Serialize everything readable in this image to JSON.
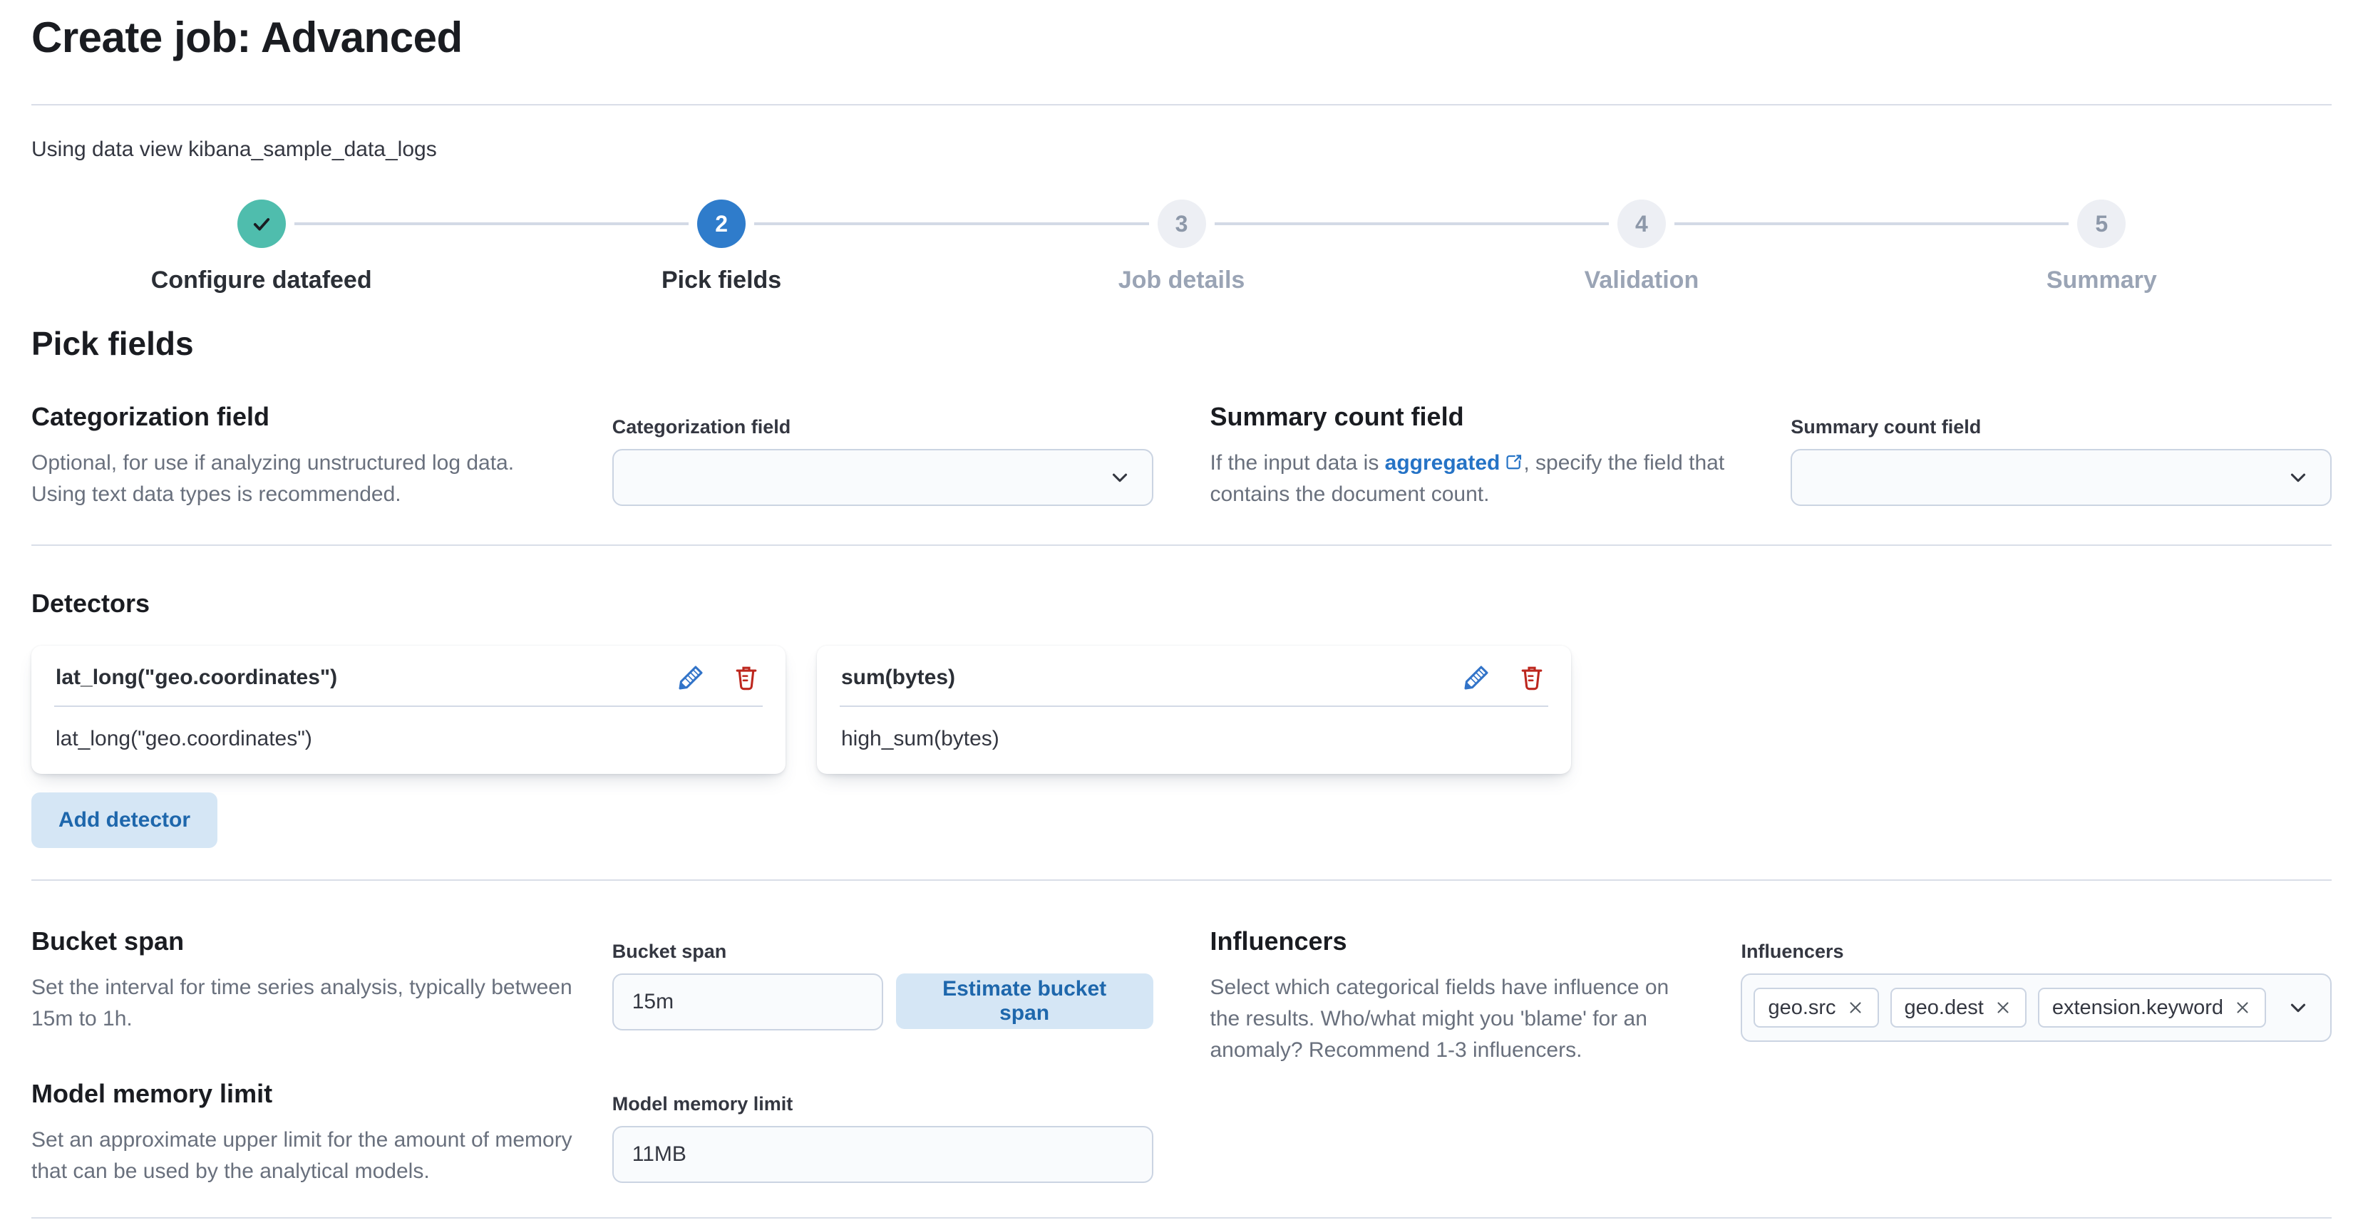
{
  "page": {
    "title": "Create job: Advanced",
    "subtitle": "Using data view kibana_sample_data_logs"
  },
  "colors": {
    "primary_blue": "#2f7ccb",
    "success_teal": "#4fbdad",
    "danger_red": "#bd271e",
    "link_blue": "#2573c6",
    "light_button_bg": "#d5e6f5",
    "light_button_text": "#1e67ac"
  },
  "steps": [
    {
      "label": "Configure datafeed",
      "status": "complete",
      "icon": "check-icon"
    },
    {
      "label": "Pick fields",
      "status": "current",
      "number": "2"
    },
    {
      "label": "Job details",
      "status": "incomplete",
      "number": "3"
    },
    {
      "label": "Validation",
      "status": "incomplete",
      "number": "4"
    },
    {
      "label": "Summary",
      "status": "incomplete",
      "number": "5"
    }
  ],
  "headings": {
    "pick_fields": "Pick fields"
  },
  "categorization": {
    "heading": "Categorization field",
    "description": "Optional, for use if analyzing unstructured log data. Using text data types is recommended.",
    "label": "Categorization field",
    "value": ""
  },
  "summary_count": {
    "heading": "Summary count field",
    "text_before": "If the input data is ",
    "link_text": "aggregated",
    "text_after": ", specify the field that contains the document count.",
    "label": "Summary count field",
    "value": ""
  },
  "detectors": {
    "heading": "Detectors",
    "cards": [
      {
        "title": "lat_long(\"geo.coordinates\")",
        "body": "lat_long(\"geo.coordinates\")"
      },
      {
        "title": "sum(bytes)",
        "body": "high_sum(bytes)"
      }
    ],
    "add_button_label": "Add detector"
  },
  "bucket_span": {
    "heading": "Bucket span",
    "description": "Set the interval for time series analysis, typically between 15m to 1h.",
    "label": "Bucket span",
    "value": "15m",
    "estimate_button_label": "Estimate bucket span"
  },
  "influencers": {
    "heading": "Influencers",
    "description": "Select which categorical fields have influence on the results. Who/what might you 'blame' for an anomaly? Recommend 1-3 influencers.",
    "label": "Influencers",
    "tags": [
      {
        "label": "geo.src"
      },
      {
        "label": "geo.dest"
      },
      {
        "label": "extension.keyword"
      }
    ]
  },
  "model_memory": {
    "heading": "Model memory limit",
    "description": "Set an approximate upper limit for the amount of memory that can be used by the analytical models.",
    "label": "Model memory limit",
    "value": "11MB"
  }
}
